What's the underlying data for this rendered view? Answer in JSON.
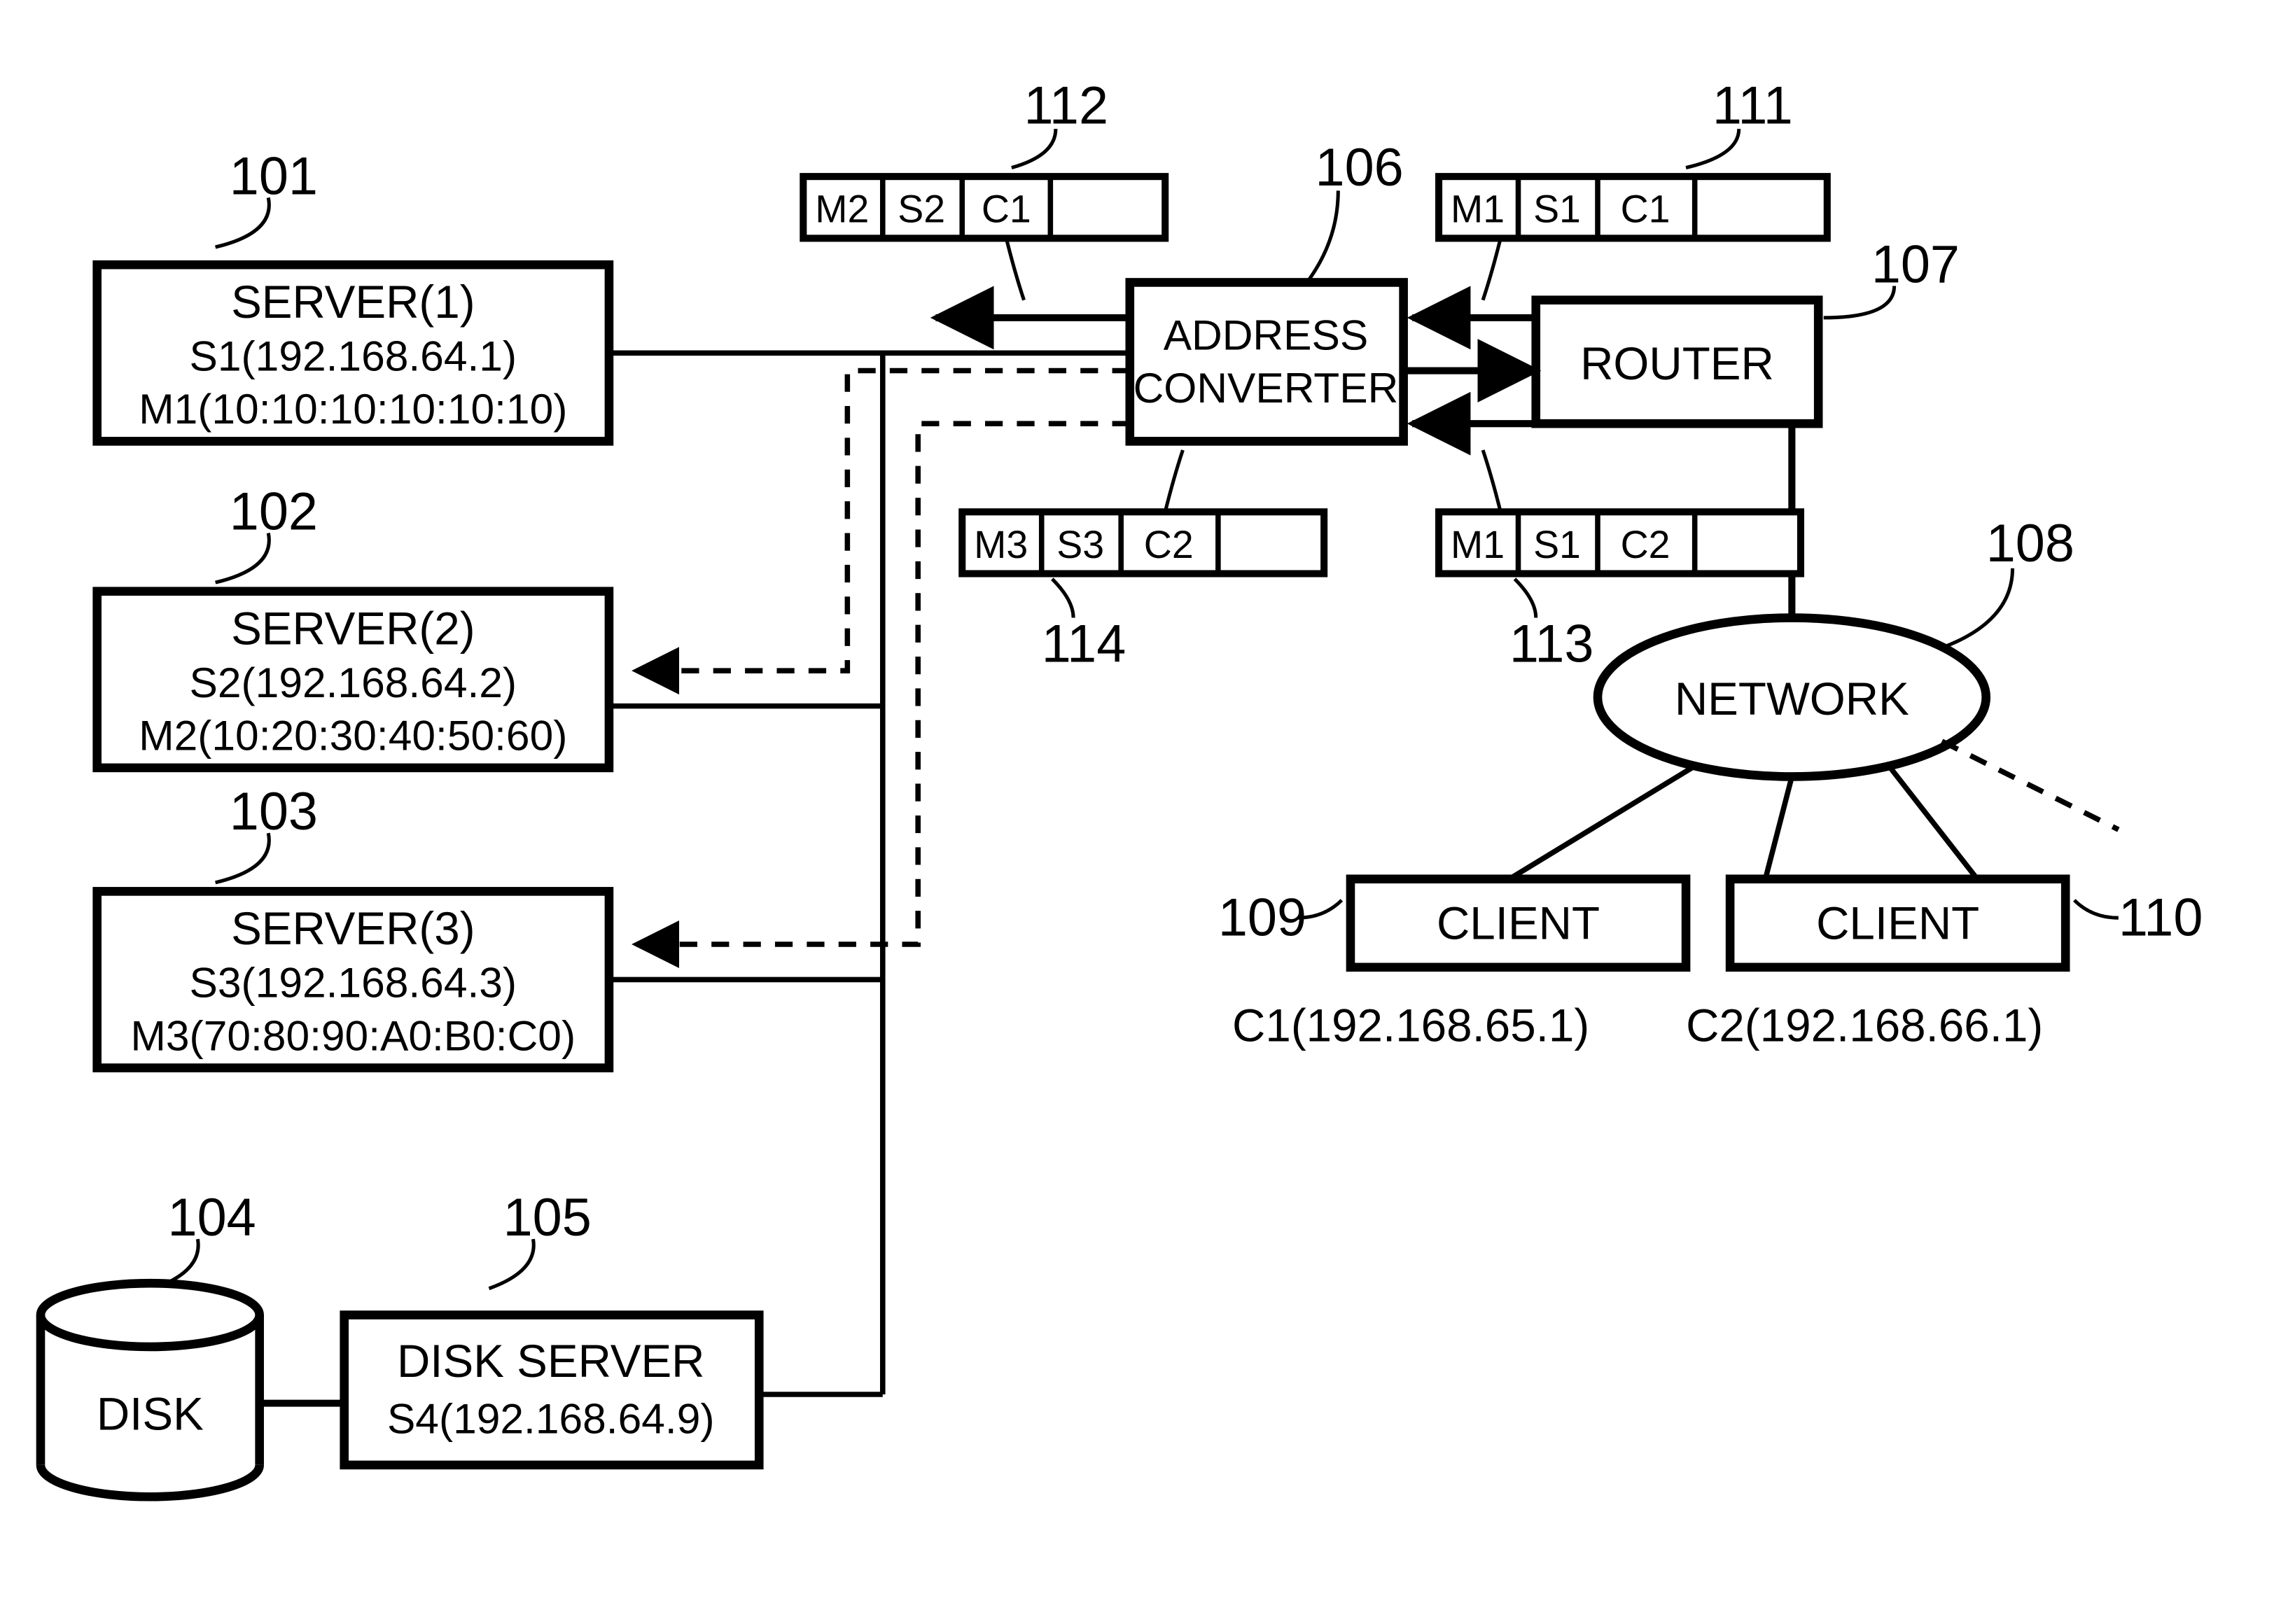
{
  "refs": {
    "r101": "101",
    "r102": "102",
    "r103": "103",
    "r104": "104",
    "r105": "105",
    "r106": "106",
    "r107": "107",
    "r108": "108",
    "r109": "109",
    "r110": "110",
    "r111": "111",
    "r112": "112",
    "r113": "113",
    "r114": "114"
  },
  "server1": {
    "title": "SERVER(1)",
    "ip": "S1(192.168.64.1)",
    "mac": "M1(10:10:10:10:10:10)"
  },
  "server2": {
    "title": "SERVER(2)",
    "ip": "S2(192.168.64.2)",
    "mac": "M2(10:20:30:40:50:60)"
  },
  "server3": {
    "title": "SERVER(3)",
    "ip": "S3(192.168.64.3)",
    "mac": "M3(70:80:90:A0:B0:C0)"
  },
  "disk": {
    "label": "DISK"
  },
  "diskServer": {
    "title": "DISK SERVER",
    "ip": "S4(192.168.64.9)"
  },
  "addressConverter": {
    "line1": "ADDRESS",
    "line2": "CONVERTER"
  },
  "router": {
    "label": "ROUTER"
  },
  "network": {
    "label": "NETWORK"
  },
  "client1": {
    "label": "CLIENT",
    "addr": "C1(192.168.65.1)"
  },
  "client2": {
    "label": "CLIENT",
    "addr": "C2(192.168.66.1)"
  },
  "pkt111": {
    "c1": "M1",
    "c2": "S1",
    "c3": "C1"
  },
  "pkt112": {
    "c1": "M2",
    "c2": "S2",
    "c3": "C1"
  },
  "pkt113": {
    "c1": "M1",
    "c2": "S1",
    "c3": "C2"
  },
  "pkt114": {
    "c1": "M3",
    "c2": "S3",
    "c3": "C2"
  }
}
